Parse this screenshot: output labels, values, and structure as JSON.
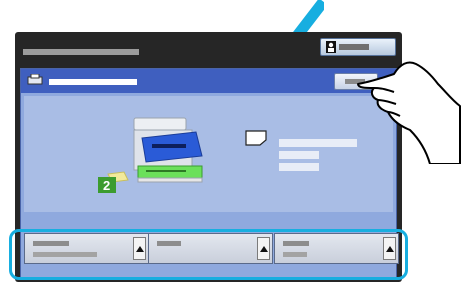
{
  "screen": {
    "background": "#262626",
    "panel_color": "#8fa9de",
    "header_color": "#3f5fbf",
    "highlight_color": "#17aee0"
  },
  "icons": {
    "checkmark": "checkmark-icon",
    "hand": "pointing-hand-icon",
    "login": "user-login-icon",
    "printer_tab": "printer-tab-icon",
    "printer": "printer-illustration-icon",
    "paper": "paper-icon",
    "step_badge": "tray-2-badge",
    "tray_arrow": "scroll-up-arrow-icon"
  },
  "step_badge": {
    "label": "2"
  },
  "tray_buttons": [
    {
      "name": "tray-button-1"
    },
    {
      "name": "tray-button-2"
    },
    {
      "name": "tray-button-3"
    }
  ]
}
